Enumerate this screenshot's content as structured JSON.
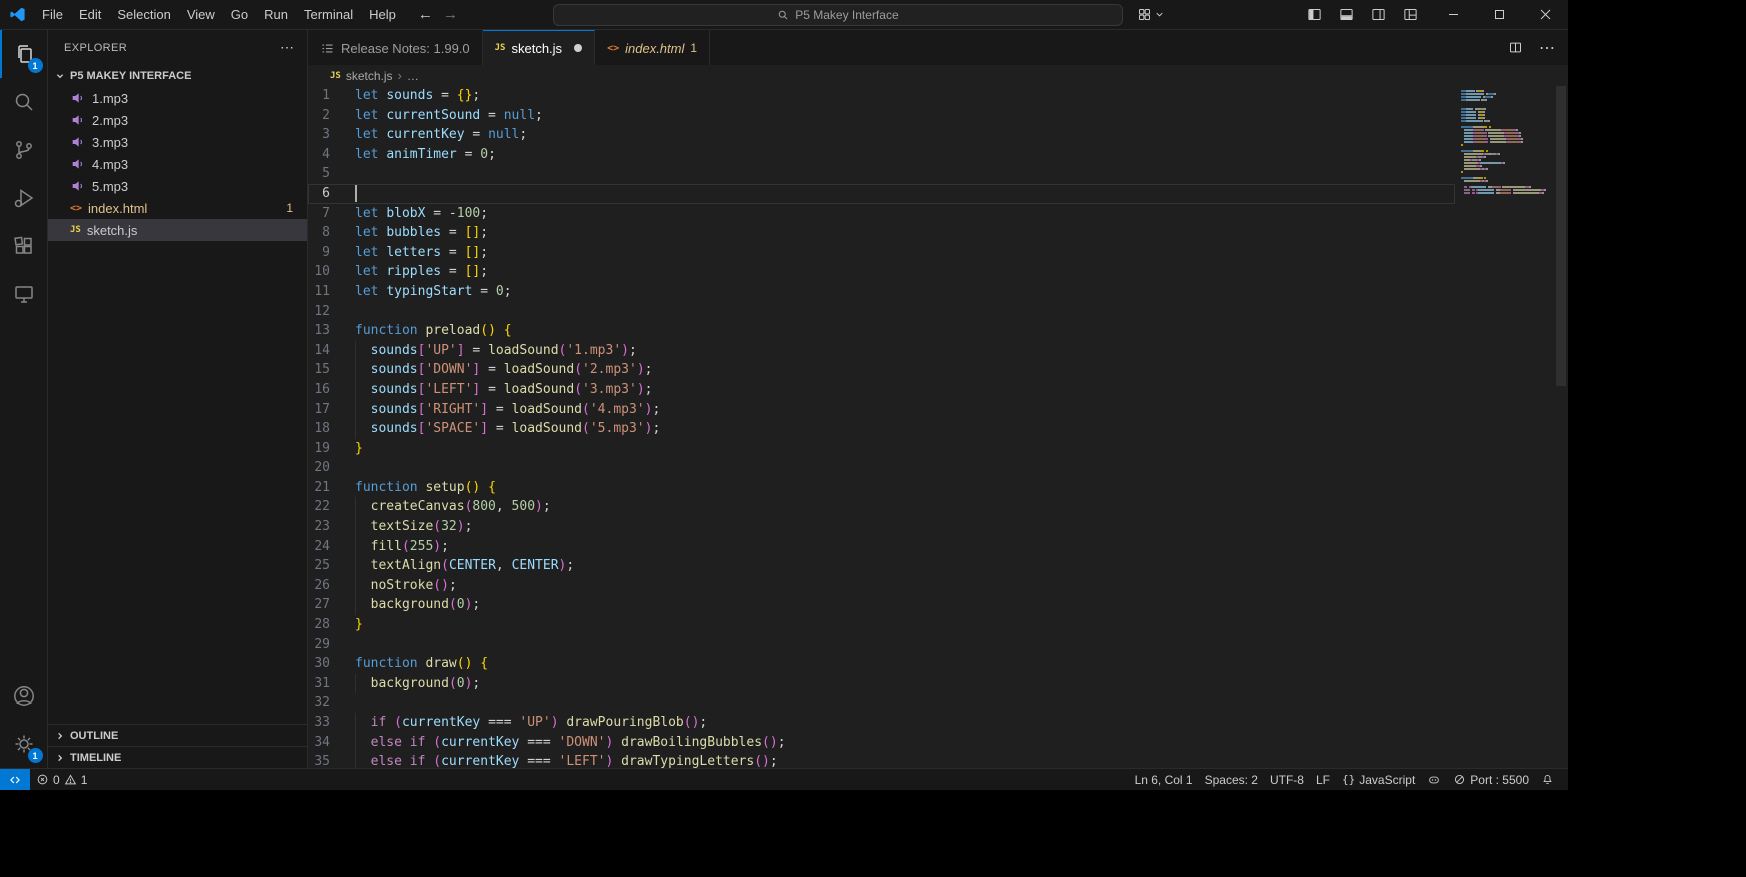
{
  "titlebar": {
    "menus": [
      "File",
      "Edit",
      "Selection",
      "View",
      "Go",
      "Run",
      "Terminal",
      "Help"
    ],
    "command_center": "P5 Makey Interface"
  },
  "activity_bar": {
    "explorer_badge": "1",
    "settings_badge": "1"
  },
  "sidebar": {
    "title": "EXPLORER",
    "folder_name": "P5 MAKEY INTERFACE",
    "files": [
      {
        "name": "1.mp3",
        "type": "audio"
      },
      {
        "name": "2.mp3",
        "type": "audio"
      },
      {
        "name": "3.mp3",
        "type": "audio"
      },
      {
        "name": "4.mp3",
        "type": "audio"
      },
      {
        "name": "5.mp3",
        "type": "audio"
      },
      {
        "name": "index.html",
        "type": "html",
        "badge": "1"
      },
      {
        "name": "sketch.js",
        "type": "js",
        "selected": true
      }
    ],
    "sections": {
      "outline": "OUTLINE",
      "timeline": "TIMELINE"
    }
  },
  "tabs": [
    {
      "label": "Release Notes: 1.99.0",
      "state": "inactive"
    },
    {
      "label": "sketch.js",
      "state": "active",
      "modified": true
    },
    {
      "label": "index.html",
      "state": "preview",
      "badge": "1"
    }
  ],
  "breadcrumb": {
    "file": "sketch.js",
    "symbol": "…"
  },
  "editor": {
    "active_line": 6,
    "cursor": {
      "line": 6,
      "col": 1
    },
    "lines": [
      [
        [
          "k",
          "let "
        ],
        [
          "v",
          "sounds"
        ],
        [
          "d",
          " = "
        ],
        [
          "b1",
          "{}"
        ],
        [
          "d",
          ";"
        ]
      ],
      [
        [
          "k",
          "let "
        ],
        [
          "v",
          "currentSound"
        ],
        [
          "d",
          " = "
        ],
        [
          "k",
          "null"
        ],
        [
          "d",
          ";"
        ]
      ],
      [
        [
          "k",
          "let "
        ],
        [
          "v",
          "currentKey"
        ],
        [
          "d",
          " = "
        ],
        [
          "k",
          "null"
        ],
        [
          "d",
          ";"
        ]
      ],
      [
        [
          "k",
          "let "
        ],
        [
          "v",
          "animTimer"
        ],
        [
          "d",
          " = "
        ],
        [
          "n",
          "0"
        ],
        [
          "d",
          ";"
        ]
      ],
      [],
      [],
      [
        [
          "k",
          "let "
        ],
        [
          "v",
          "blobX"
        ],
        [
          "d",
          " = -"
        ],
        [
          "n",
          "100"
        ],
        [
          "d",
          ";"
        ]
      ],
      [
        [
          "k",
          "let "
        ],
        [
          "v",
          "bubbles"
        ],
        [
          "d",
          " = "
        ],
        [
          "b1",
          "[]"
        ],
        [
          "d",
          ";"
        ]
      ],
      [
        [
          "k",
          "let "
        ],
        [
          "v",
          "letters"
        ],
        [
          "d",
          " = "
        ],
        [
          "b1",
          "[]"
        ],
        [
          "d",
          ";"
        ]
      ],
      [
        [
          "k",
          "let "
        ],
        [
          "v",
          "ripples"
        ],
        [
          "d",
          " = "
        ],
        [
          "b1",
          "[]"
        ],
        [
          "d",
          ";"
        ]
      ],
      [
        [
          "k",
          "let "
        ],
        [
          "v",
          "typingStart"
        ],
        [
          "d",
          " = "
        ],
        [
          "n",
          "0"
        ],
        [
          "d",
          ";"
        ]
      ],
      [],
      [
        [
          "k",
          "function "
        ],
        [
          "f",
          "preload"
        ],
        [
          "b1",
          "()"
        ],
        [
          "d",
          " "
        ],
        [
          "b1",
          "{"
        ]
      ],
      [
        [
          "d",
          "  "
        ],
        [
          "v",
          "sounds"
        ],
        [
          "b2",
          "["
        ],
        [
          "s",
          "'UP'"
        ],
        [
          "b2",
          "]"
        ],
        [
          "d",
          " = "
        ],
        [
          "f",
          "loadSound"
        ],
        [
          "b2",
          "("
        ],
        [
          "s",
          "'1.mp3'"
        ],
        [
          "b2",
          ")"
        ],
        [
          "d",
          ";"
        ]
      ],
      [
        [
          "d",
          "  "
        ],
        [
          "v",
          "sounds"
        ],
        [
          "b2",
          "["
        ],
        [
          "s",
          "'DOWN'"
        ],
        [
          "b2",
          "]"
        ],
        [
          "d",
          " = "
        ],
        [
          "f",
          "loadSound"
        ],
        [
          "b2",
          "("
        ],
        [
          "s",
          "'2.mp3'"
        ],
        [
          "b2",
          ")"
        ],
        [
          "d",
          ";"
        ]
      ],
      [
        [
          "d",
          "  "
        ],
        [
          "v",
          "sounds"
        ],
        [
          "b2",
          "["
        ],
        [
          "s",
          "'LEFT'"
        ],
        [
          "b2",
          "]"
        ],
        [
          "d",
          " = "
        ],
        [
          "f",
          "loadSound"
        ],
        [
          "b2",
          "("
        ],
        [
          "s",
          "'3.mp3'"
        ],
        [
          "b2",
          ")"
        ],
        [
          "d",
          ";"
        ]
      ],
      [
        [
          "d",
          "  "
        ],
        [
          "v",
          "sounds"
        ],
        [
          "b2",
          "["
        ],
        [
          "s",
          "'RIGHT'"
        ],
        [
          "b2",
          "]"
        ],
        [
          "d",
          " = "
        ],
        [
          "f",
          "loadSound"
        ],
        [
          "b2",
          "("
        ],
        [
          "s",
          "'4.mp3'"
        ],
        [
          "b2",
          ")"
        ],
        [
          "d",
          ";"
        ]
      ],
      [
        [
          "d",
          "  "
        ],
        [
          "v",
          "sounds"
        ],
        [
          "b2",
          "["
        ],
        [
          "s",
          "'SPACE'"
        ],
        [
          "b2",
          "]"
        ],
        [
          "d",
          " = "
        ],
        [
          "f",
          "loadSound"
        ],
        [
          "b2",
          "("
        ],
        [
          "s",
          "'5.mp3'"
        ],
        [
          "b2",
          ")"
        ],
        [
          "d",
          ";"
        ]
      ],
      [
        [
          "b1",
          "}"
        ]
      ],
      [],
      [
        [
          "k",
          "function "
        ],
        [
          "f",
          "setup"
        ],
        [
          "b1",
          "()"
        ],
        [
          "d",
          " "
        ],
        [
          "b1",
          "{"
        ]
      ],
      [
        [
          "d",
          "  "
        ],
        [
          "f",
          "createCanvas"
        ],
        [
          "b2",
          "("
        ],
        [
          "n",
          "800"
        ],
        [
          "d",
          ", "
        ],
        [
          "n",
          "500"
        ],
        [
          "b2",
          ")"
        ],
        [
          "d",
          ";"
        ]
      ],
      [
        [
          "d",
          "  "
        ],
        [
          "f",
          "textSize"
        ],
        [
          "b2",
          "("
        ],
        [
          "n",
          "32"
        ],
        [
          "b2",
          ")"
        ],
        [
          "d",
          ";"
        ]
      ],
      [
        [
          "d",
          "  "
        ],
        [
          "f",
          "fill"
        ],
        [
          "b2",
          "("
        ],
        [
          "n",
          "255"
        ],
        [
          "b2",
          ")"
        ],
        [
          "d",
          ";"
        ]
      ],
      [
        [
          "d",
          "  "
        ],
        [
          "f",
          "textAlign"
        ],
        [
          "b2",
          "("
        ],
        [
          "v",
          "CENTER"
        ],
        [
          "d",
          ", "
        ],
        [
          "v",
          "CENTER"
        ],
        [
          "b2",
          ")"
        ],
        [
          "d",
          ";"
        ]
      ],
      [
        [
          "d",
          "  "
        ],
        [
          "f",
          "noStroke"
        ],
        [
          "b2",
          "()"
        ],
        [
          "d",
          ";"
        ]
      ],
      [
        [
          "d",
          "  "
        ],
        [
          "f",
          "background"
        ],
        [
          "b2",
          "("
        ],
        [
          "n",
          "0"
        ],
        [
          "b2",
          ")"
        ],
        [
          "d",
          ";"
        ]
      ],
      [
        [
          "b1",
          "}"
        ]
      ],
      [],
      [
        [
          "k",
          "function "
        ],
        [
          "f",
          "draw"
        ],
        [
          "b1",
          "()"
        ],
        [
          "d",
          " "
        ],
        [
          "b1",
          "{"
        ]
      ],
      [
        [
          "d",
          "  "
        ],
        [
          "f",
          "background"
        ],
        [
          "b2",
          "("
        ],
        [
          "n",
          "0"
        ],
        [
          "b2",
          ")"
        ],
        [
          "d",
          ";"
        ]
      ],
      [],
      [
        [
          "d",
          "  "
        ],
        [
          "c",
          "if"
        ],
        [
          "d",
          " "
        ],
        [
          "b2",
          "("
        ],
        [
          "v",
          "currentKey"
        ],
        [
          "d",
          " === "
        ],
        [
          "s",
          "'UP'"
        ],
        [
          "b2",
          ")"
        ],
        [
          "d",
          " "
        ],
        [
          "f",
          "drawPouringBlob"
        ],
        [
          "b2",
          "()"
        ],
        [
          "d",
          ";"
        ]
      ],
      [
        [
          "d",
          "  "
        ],
        [
          "c",
          "else"
        ],
        [
          "d",
          " "
        ],
        [
          "c",
          "if"
        ],
        [
          "d",
          " "
        ],
        [
          "b2",
          "("
        ],
        [
          "v",
          "currentKey"
        ],
        [
          "d",
          " === "
        ],
        [
          "s",
          "'DOWN'"
        ],
        [
          "b2",
          ")"
        ],
        [
          "d",
          " "
        ],
        [
          "f",
          "drawBoilingBubbles"
        ],
        [
          "b2",
          "()"
        ],
        [
          "d",
          ";"
        ]
      ],
      [
        [
          "d",
          "  "
        ],
        [
          "c",
          "else"
        ],
        [
          "d",
          " "
        ],
        [
          "c",
          "if"
        ],
        [
          "d",
          " "
        ],
        [
          "b2",
          "("
        ],
        [
          "v",
          "currentKey"
        ],
        [
          "d",
          " === "
        ],
        [
          "s",
          "'LEFT'"
        ],
        [
          "b2",
          ")"
        ],
        [
          "d",
          " "
        ],
        [
          "f",
          "drawTypingLetters"
        ],
        [
          "b2",
          "()"
        ],
        [
          "d",
          ";"
        ]
      ]
    ]
  },
  "status_bar": {
    "errors": "0",
    "warnings": "1",
    "line_col": "Ln 6, Col 1",
    "indent": "Spaces: 2",
    "encoding": "UTF-8",
    "eol": "LF",
    "language": "JavaScript",
    "port": "Port : 5500"
  }
}
